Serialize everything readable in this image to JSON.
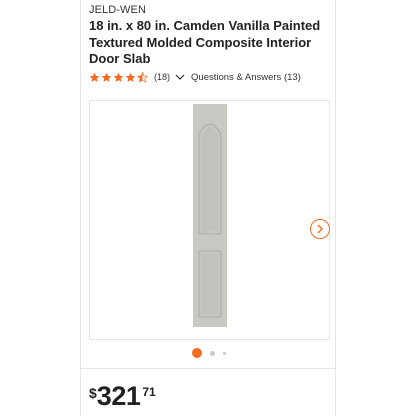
{
  "product": {
    "brand": "JELD-WEN",
    "title": "18 in. x 80 in. Camden Vanilla Painted Textured Molded Composite Interior Door Slab"
  },
  "rating": {
    "stars": 4.5,
    "count_text": "(18)",
    "qa_text": "Questions & Answers (13)"
  },
  "gallery": {
    "current_index": 1,
    "indicator_count": 3,
    "next_icon": "chevron-right-icon"
  },
  "price": {
    "currency": "$",
    "dollars": "321",
    "cents": "71"
  },
  "colors": {
    "accent": "#f36c21",
    "door": "#c9c8c3",
    "text": "#333333"
  }
}
